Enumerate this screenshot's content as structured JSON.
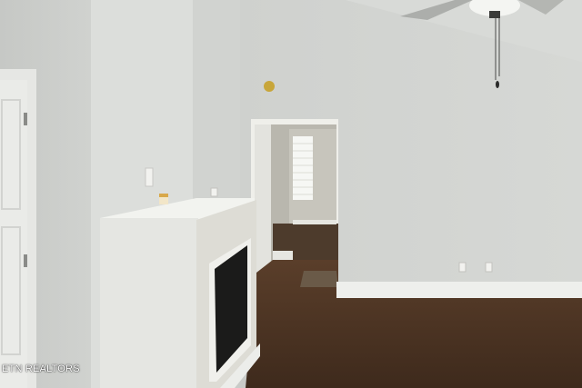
{
  "scene": {
    "description_free": true,
    "watermark": "ETN REALTORS"
  },
  "colors": {
    "wall": "#d3d5d2",
    "wall_shadow": "#c3c5c2",
    "ceiling": "#dcdedb",
    "floor": "#4a3322",
    "baseboard": "#eeefec",
    "door": "#eaebe8",
    "fireplace_surround": "#e4e5e1",
    "firebox": "#1b1b1a"
  }
}
